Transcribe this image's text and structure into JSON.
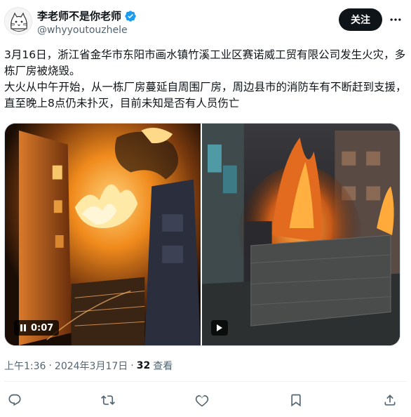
{
  "author": {
    "display_name": "李老师不是你老师",
    "handle": "@whyyoutouzhele",
    "verified": true,
    "avatar_icon": "cat-sketch-avatar"
  },
  "header": {
    "follow_label": "关注",
    "more_icon": "more-horizontal-icon"
  },
  "tweet": {
    "paragraph_1": "3月16日，浙江省金华市东阳市画水镇竹溪工业区赛诺威工贸有限公司发生火灾，多栋厂房被烧毁。",
    "paragraph_2": "大火从中午开始，从一栋厂房蔓延自周围厂房，周边县市的消防车有不断赶到支援，直至晚上8点仍未扑灭，目前未知是否有人员伤亡"
  },
  "media": {
    "video_1": {
      "duration": "0:07",
      "state_icon": "pause-icon"
    },
    "video_2": {
      "state_icon": "play-icon"
    }
  },
  "meta": {
    "time": "上午1:36",
    "separator_1": "·",
    "date": "2024年3月17日",
    "separator_2": "·",
    "views_count": "32",
    "views_label": "查看"
  },
  "actions": [
    {
      "name": "reply",
      "icon": "reply-icon"
    },
    {
      "name": "repost",
      "icon": "repost-icon"
    },
    {
      "name": "like",
      "icon": "heart-icon"
    },
    {
      "name": "bookmark",
      "icon": "bookmark-icon"
    },
    {
      "name": "share",
      "icon": "share-icon"
    }
  ],
  "colors": {
    "text_primary": "#0f1419",
    "text_secondary": "#536471",
    "verified_blue": "#1d9bf0",
    "follow_button_bg": "#0f1419"
  }
}
